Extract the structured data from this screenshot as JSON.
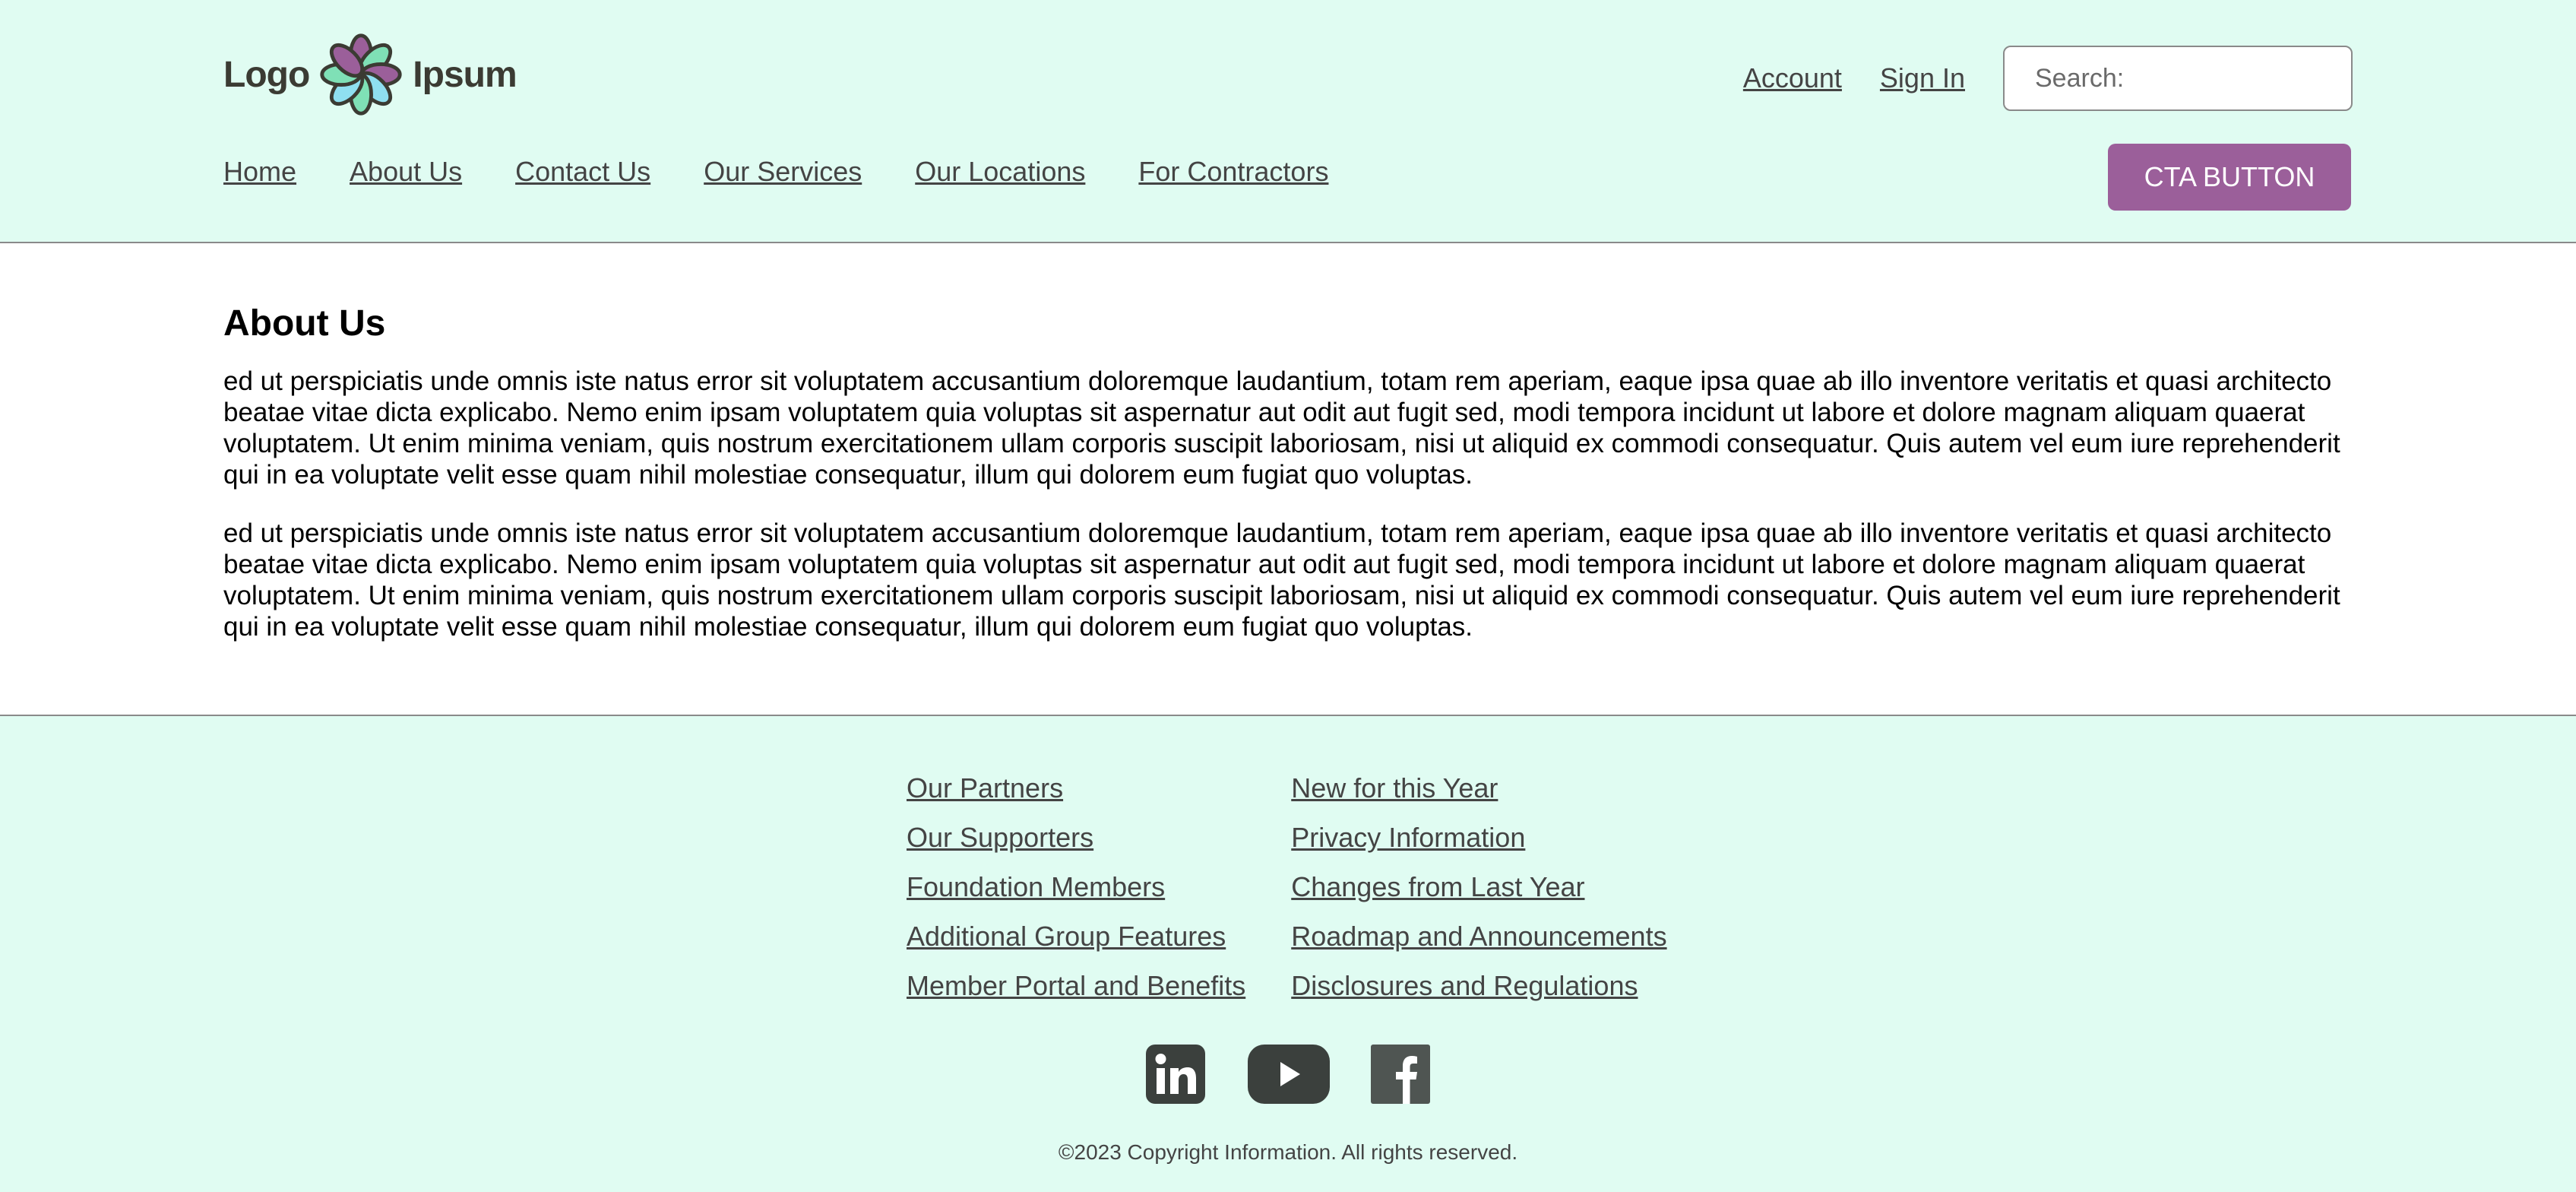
{
  "header": {
    "logo": {
      "word_left": "Logo",
      "word_right": "Ipsum"
    },
    "utility_links": [
      "Account",
      "Sign In"
    ],
    "search": {
      "placeholder": "Search:",
      "value": ""
    },
    "nav": [
      "Home",
      "About Us",
      "Contact Us",
      "Our Services",
      "Our Locations",
      "For Contractors"
    ],
    "cta_label": "CTA BUTTON"
  },
  "main": {
    "title": "About Us",
    "paragraphs": [
      "ed ut perspiciatis unde omnis iste natus error sit voluptatem accusantium doloremque laudantium, totam rem aperiam, eaque ipsa quae ab illo inventore veritatis et quasi architecto beatae vitae dicta explicabo. Nemo enim ipsam voluptatem quia voluptas sit aspernatur aut odit aut fugit sed, modi tempora incidunt ut labore et dolore magnam aliquam quaerat voluptatem. Ut enim minima veniam, quis nostrum exercitationem ullam corporis suscipit laboriosam, nisi ut aliquid ex commodi consequatur. Quis autem vel eum iure reprehenderit qui in ea voluptate velit esse quam nihil molestiae consequatur, illum qui dolorem eum fugiat quo voluptas.",
      "ed ut perspiciatis unde omnis iste natus error sit voluptatem accusantium doloremque laudantium, totam rem aperiam, eaque ipsa quae ab illo inventore veritatis et quasi architecto beatae vitae dicta explicabo. Nemo enim ipsam voluptatem quia voluptas sit aspernatur aut odit aut fugit sed, modi tempora incidunt ut labore et dolore magnam aliquam quaerat voluptatem. Ut enim minima veniam, quis nostrum exercitationem ullam corporis suscipit laboriosam, nisi ut aliquid ex commodi consequatur. Quis autem vel eum iure reprehenderit qui in ea voluptate velit esse quam nihil molestiae consequatur, illum qui dolorem eum fugiat quo voluptas."
    ]
  },
  "footer": {
    "col1": [
      "Our Partners",
      "Our Supporters",
      "Foundation Members",
      "Additional Group Features",
      "Member Portal and Benefits"
    ],
    "col2": [
      "New for this Year",
      "Privacy Information",
      "Changes from Last Year",
      "Roadmap and Announcements",
      "Disclosures and Regulations"
    ],
    "social": [
      "linkedin-icon",
      "youtube-icon",
      "facebook-icon"
    ],
    "copyright": "©2023 Copyright Information. All rights reserved."
  },
  "colors": {
    "header_bg": "#e0fcf2",
    "cta_bg": "#9b5f9a",
    "link": "#444444",
    "icon": "#3b403d"
  }
}
